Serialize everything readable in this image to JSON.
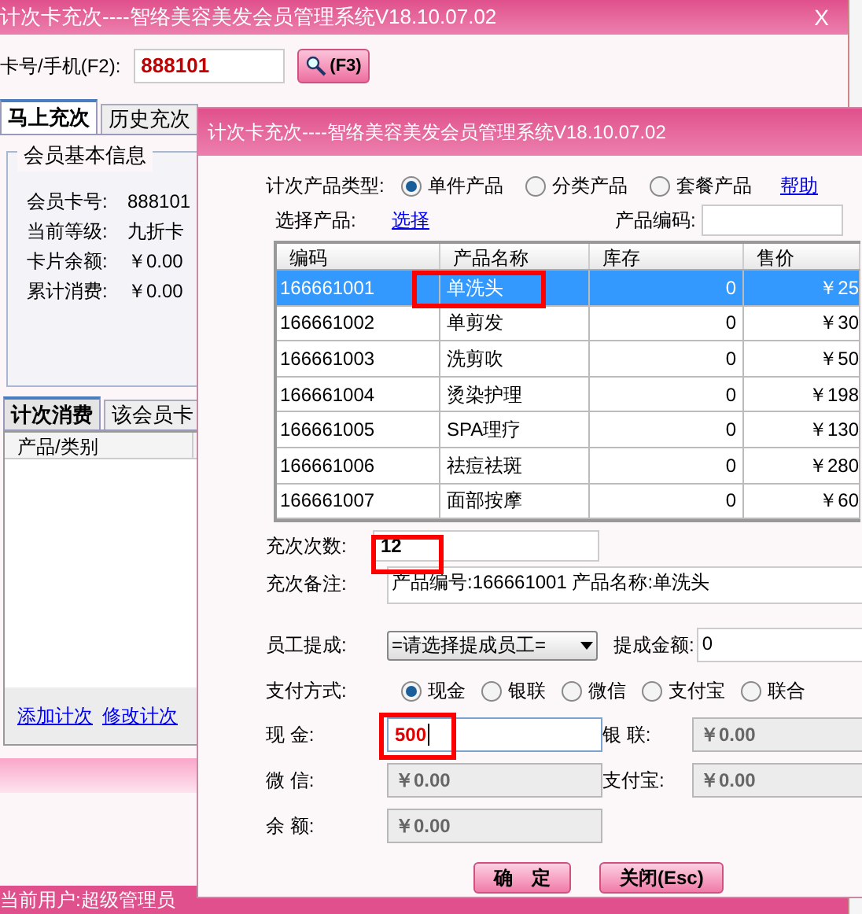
{
  "main_window": {
    "title": "计次卡充次----智络美容美发会员管理系统V18.10.07.02",
    "close": "X",
    "card_field": {
      "label": "卡号/手机(F2):",
      "value": "888101"
    },
    "search_button": {
      "label": "(F3)"
    },
    "tabs": [
      {
        "label": "马上充次",
        "selected": true
      },
      {
        "label": "历史充次",
        "selected": false
      }
    ],
    "member_info": {
      "title": "会员基本信息",
      "fields": [
        {
          "label": "会员卡号:",
          "value": "888101"
        },
        {
          "label": "当前等级:",
          "value": "九折卡"
        },
        {
          "label": "卡片余额:",
          "value": "￥0.00"
        },
        {
          "label": "累计消费:",
          "value": "￥0.00"
        }
      ]
    },
    "lower_tabs": [
      {
        "label": "计次消费",
        "selected": true
      },
      {
        "label": "该会员卡",
        "selected": false
      }
    ],
    "list": {
      "columns": [
        "产品/类别"
      ]
    },
    "links": [
      "添加计次",
      "修改计次"
    ],
    "status_bar": [
      "当前用户:超级管理员"
    ]
  },
  "dialog": {
    "title": "计次卡充次----智络美容美发会员管理系统V18.10.07.02",
    "product_type": {
      "label": "计次产品类型:",
      "options": [
        {
          "label": "单件产品",
          "selected": true
        },
        {
          "label": "分类产品",
          "selected": false
        },
        {
          "label": "套餐产品",
          "selected": false
        }
      ]
    },
    "help_link": "帮助",
    "select_product": {
      "label": "选择产品:",
      "link": "选择"
    },
    "product_code": {
      "label": "产品编码:"
    },
    "table": {
      "columns": [
        "编码",
        "产品名称",
        "库存",
        "售价"
      ],
      "rows": [
        {
          "cells": [
            "166661001",
            "单洗头",
            "0",
            "￥25"
          ],
          "selected": true
        },
        {
          "cells": [
            "166661002",
            "单剪发",
            "0",
            "￥30"
          ],
          "selected": false
        },
        {
          "cells": [
            "166661003",
            "洗剪吹",
            "0",
            "￥50"
          ],
          "selected": false
        },
        {
          "cells": [
            "166661004",
            "烫染护理",
            "0",
            "￥198"
          ],
          "selected": false
        },
        {
          "cells": [
            "166661005",
            "SPA理疗",
            "0",
            "￥130"
          ],
          "selected": false
        },
        {
          "cells": [
            "166661006",
            "祛痘祛斑",
            "0",
            "￥280"
          ],
          "selected": false
        },
        {
          "cells": [
            "166661007",
            "面部按摩",
            "0",
            "￥60"
          ],
          "selected": false
        }
      ]
    },
    "count": {
      "label": "充次次数:",
      "value": "12"
    },
    "note": {
      "label": "充次备注:",
      "value": "产品编号:166661001 产品名称:单洗头"
    },
    "staff": {
      "label": "员工提成:",
      "value": "=请选择提成员工="
    },
    "commission": {
      "label": "提成金额:",
      "value": "0"
    },
    "payment": {
      "label": "支付方式:",
      "options": [
        {
          "label": "现金",
          "selected": true
        },
        {
          "label": "银联",
          "selected": false
        },
        {
          "label": "微信",
          "selected": false
        },
        {
          "label": "支付宝",
          "selected": false
        },
        {
          "label": "联合",
          "selected": false
        }
      ]
    },
    "amounts": [
      {
        "label": "现 金:",
        "value": "500",
        "disabled": false
      },
      {
        "label": "银 联:",
        "value": "￥0.00",
        "disabled": true
      },
      {
        "label": "微 信:",
        "value": "￥0.00",
        "disabled": true
      },
      {
        "label": "支付宝:",
        "value": "￥0.00",
        "disabled": true
      },
      {
        "label": "余 额:",
        "value": "￥0.00",
        "disabled": true
      }
    ],
    "buttons": [
      "确　定",
      "关闭(Esc)"
    ]
  }
}
